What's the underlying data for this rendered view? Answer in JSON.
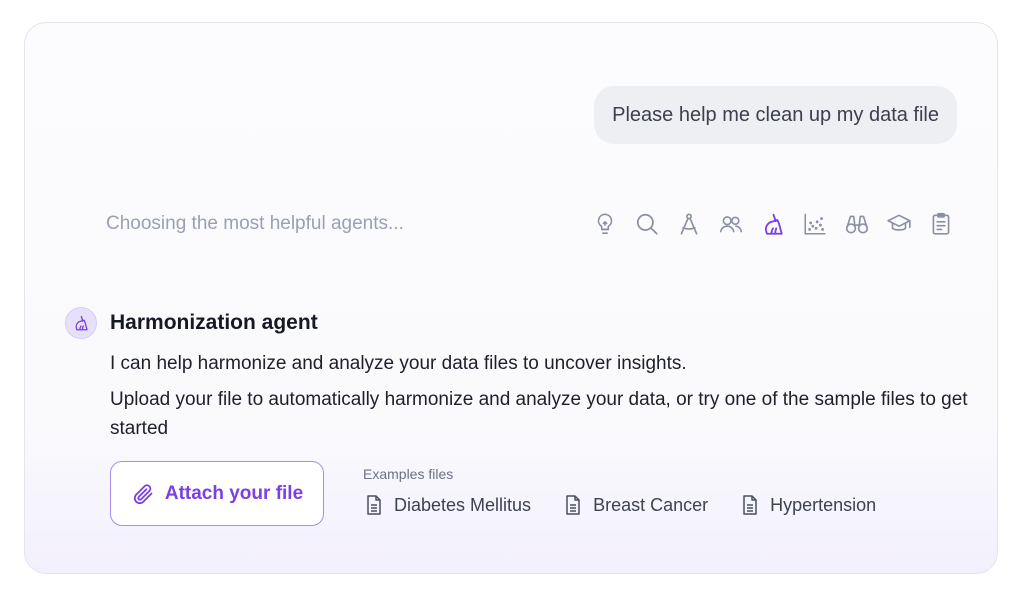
{
  "chat": {
    "user_message": "Please help me clean up my data file",
    "status_text": "Choosing the most helpful agents...",
    "agent_icons": [
      {
        "name": "lightbulb-icon",
        "active": false
      },
      {
        "name": "search-icon",
        "active": false
      },
      {
        "name": "compass-icon",
        "active": false
      },
      {
        "name": "users-icon",
        "active": false
      },
      {
        "name": "broom-icon",
        "active": true
      },
      {
        "name": "scatter-chart-icon",
        "active": false
      },
      {
        "name": "binoculars-icon",
        "active": false
      },
      {
        "name": "graduation-cap-icon",
        "active": false
      },
      {
        "name": "clipboard-icon",
        "active": false
      }
    ],
    "agent": {
      "name": "Harmonization agent",
      "icon": "broom-icon",
      "message_1": "I can help harmonize and analyze your data files to uncover insights.",
      "message_2": "Upload your file to automatically harmonize and analyze your data, or try one of the sample files to get started"
    },
    "attach": {
      "label": "Attach your file",
      "icon": "paperclip-icon"
    },
    "examples": {
      "title": "Examples files",
      "files": [
        "Diabetes Mellitus",
        "Breast Cancer",
        "Hypertension"
      ]
    }
  },
  "colors": {
    "accent": "#7b3fe4",
    "icon_gray": "#8a8fa3",
    "bubble_bg": "#eeeff3",
    "avatar_bg": "#e7e0fb"
  }
}
